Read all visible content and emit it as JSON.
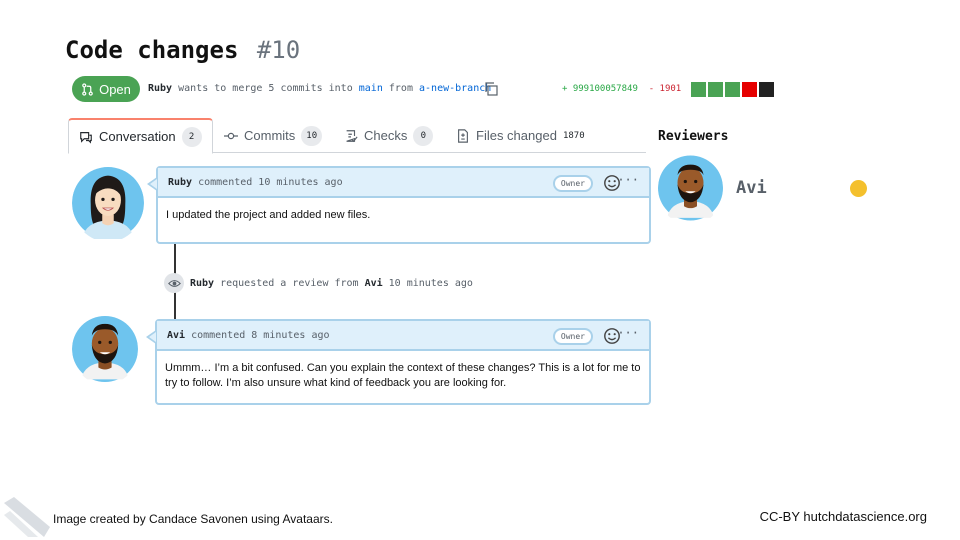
{
  "title": {
    "text": "Code changes",
    "number": "#10"
  },
  "pr": {
    "status": "Open",
    "author": "Ruby",
    "merge_text": "wants to merge 5 commits into",
    "base_branch": "main",
    "from_text": "from",
    "head_branch": "a-new-branch",
    "additions": "+ 999100057849",
    "deletions": "- 1901",
    "diff_box_colors": [
      "#4aa354",
      "#4aa354",
      "#4aa354",
      "#e60000",
      "#222222"
    ]
  },
  "tabs": [
    {
      "label": "Conversation",
      "count": "2",
      "icon": "comment-icon"
    },
    {
      "label": "Commits",
      "count": "10",
      "icon": "commit-icon"
    },
    {
      "label": "Checks",
      "count": "0",
      "icon": "checklist-icon"
    },
    {
      "label": "Files changed",
      "count": "1870",
      "icon": "file-diff-icon"
    }
  ],
  "sidebar": {
    "reviewers_title": "Reviewers",
    "reviewer_name": "Avi",
    "reviewer_status_color": "#f4c02d"
  },
  "comments": [
    {
      "author": "Ruby",
      "meta": "commented 10 minutes ago",
      "badge": "Owner",
      "body": "I updated the project and added new files."
    },
    {
      "author": "Avi",
      "meta": "commented 8 minutes ago",
      "badge": "Owner",
      "body": "Ummm… I’m a bit confused. Can you explain the context of these changes? This is a lot for me to try to follow.  I’m also unsure what kind of feedback you are looking for."
    }
  ],
  "review_event": {
    "actor": "Ruby",
    "text": "requested a review from",
    "reviewer": "Avi",
    "time": "10 minutes ago"
  },
  "footer": {
    "credit": "Image created by Candace Savonen using Avataars.",
    "license": "CC-BY  hutchdatascience.org"
  }
}
